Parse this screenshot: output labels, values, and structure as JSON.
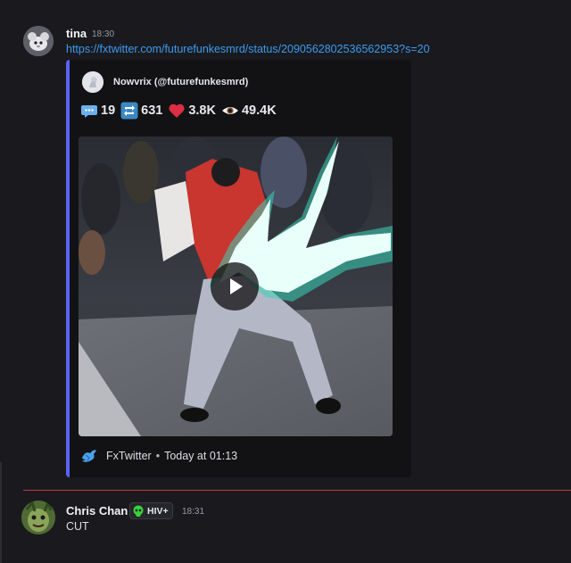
{
  "messages": {
    "tina": {
      "username": "tina",
      "timestamp": "18:30",
      "link": "https://fxtwitter.com/futurefunkesmrd/status/2090562802536562953?s=20",
      "embed": {
        "author": "Nowvrix (@futurefunkesmrd)",
        "stats": {
          "replies": "19",
          "retweets": "631",
          "likes": "3.8K",
          "views": "49.4K"
        },
        "footer_source": "FxTwitter",
        "footer_separator": "•",
        "footer_time": "Today at 01:13",
        "accent_color": "#5865f2"
      }
    },
    "chris": {
      "username": "Chris Chan",
      "role_badge": "HIV+",
      "timestamp": "18:31",
      "text": "CUT"
    }
  },
  "icons": {
    "replies": "speech-bubble-icon",
    "retweets": "retweet-icon",
    "likes": "heart-icon",
    "views": "eye-icon",
    "play": "play-icon",
    "footer": "fxtwitter-bird-icon",
    "badge": "skull-icon"
  },
  "colors": {
    "background": "#1a1a1e",
    "link": "#3b9bf0",
    "new_message_divider": "#c7343f"
  }
}
